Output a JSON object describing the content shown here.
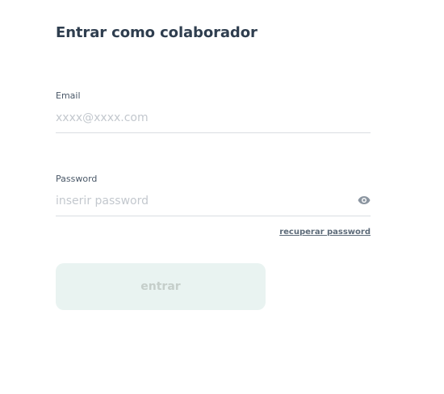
{
  "form": {
    "title": "Entrar como colaborador",
    "email": {
      "label": "Email",
      "placeholder": "xxxx@xxxx.com",
      "value": ""
    },
    "password": {
      "label": "Password",
      "placeholder": "inserir password",
      "value": "",
      "toggle_icon": "eye-icon"
    },
    "recover_link": "recuperar password",
    "submit_label": "entrar",
    "submit_enabled": false
  },
  "colors": {
    "text_primary": "#2f3e4f",
    "placeholder": "#c3c8ce",
    "divider": "#d9dde2",
    "button_disabled_bg": "#e9f3f1",
    "button_disabled_text": "#c5ceca",
    "icon": "#8b95a0"
  }
}
